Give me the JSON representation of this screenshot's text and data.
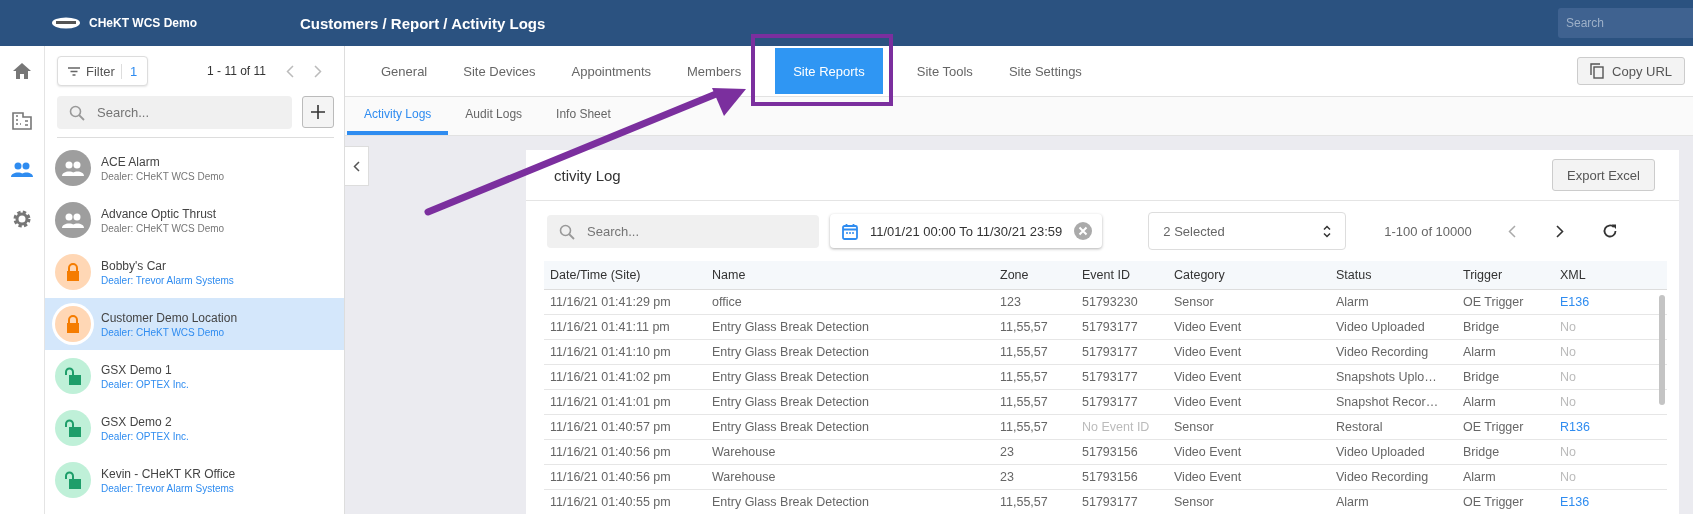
{
  "header": {
    "brand": "CHeKT WCS Demo",
    "breadcrumb": "Customers / Report / Activity Logs",
    "search": {
      "placeholder": "Search"
    }
  },
  "nav_rail": [
    {
      "kind": "home",
      "selected": false
    },
    {
      "kind": "building",
      "selected": false
    },
    {
      "kind": "people",
      "selected": true
    },
    {
      "kind": "gear",
      "selected": false
    }
  ],
  "customer_panel": {
    "filter": {
      "label": "Filter",
      "count": "1"
    },
    "pagination": "1 - 11 of 11",
    "search": {
      "placeholder": "Search..."
    },
    "items": [
      {
        "name": "ACE Alarm",
        "dealer": "Dealer: CHeKT WCS Demo",
        "kind": "group",
        "dealer_link": false,
        "selected": false
      },
      {
        "name": "Advance Optic Thrust",
        "dealer": "Dealer: CHeKT WCS Demo",
        "kind": "group",
        "dealer_link": false,
        "selected": false
      },
      {
        "name": "Bobby's Car",
        "dealer": "Dealer: Trevor Alarm Systems",
        "kind": "locked",
        "dealer_link": true,
        "selected": false
      },
      {
        "name": "Customer Demo Location",
        "dealer": "Dealer: CHeKT WCS Demo",
        "kind": "locked",
        "dealer_link": true,
        "selected": true
      },
      {
        "name": "GSX Demo 1",
        "dealer": "Dealer: OPTEX Inc.",
        "kind": "unlocked",
        "dealer_link": true,
        "selected": false
      },
      {
        "name": "GSX Demo 2",
        "dealer": "Dealer: OPTEX Inc.",
        "kind": "unlocked",
        "dealer_link": true,
        "selected": false
      },
      {
        "name": "Kevin - CHeKT KR Office",
        "dealer": "Dealer: Trevor Alarm Systems",
        "kind": "unlocked",
        "dealer_link": true,
        "selected": false
      }
    ]
  },
  "tabs": [
    {
      "label": "General",
      "selected": false
    },
    {
      "label": "Site Devices",
      "selected": false
    },
    {
      "label": "Appointments",
      "selected": false
    },
    {
      "label": "Members",
      "selected": false
    },
    {
      "label": "Site Reports",
      "selected": true
    },
    {
      "label": "Site Tools",
      "selected": false
    },
    {
      "label": "Site Settings",
      "selected": false
    }
  ],
  "copy_url_button": "Copy URL",
  "subtabs": [
    {
      "label": "Activity Logs",
      "selected": true
    },
    {
      "label": "Audit Logs",
      "selected": false
    },
    {
      "label": "Info Sheet",
      "selected": false
    }
  ],
  "card": {
    "title": "ctivity Log",
    "export_button": "Export Excel",
    "search": {
      "placeholder": "Search..."
    },
    "date_range": "11/01/21 00:00 To 11/30/21 23:59",
    "category_select": "2 Selected",
    "pagination": "1-100 of 10000",
    "table": {
      "columns": [
        "Date/Time (Site)",
        "Name",
        "Zone",
        "Event ID",
        "Category",
        "Status",
        "Trigger",
        "XML"
      ],
      "rows": [
        {
          "datetime": "11/16/21 01:41:29 pm",
          "name": "office",
          "zone": "123",
          "event_id": {
            "text": "51793230",
            "muted": false
          },
          "category": "Sensor",
          "status": "Alarm",
          "trigger": "OE Trigger",
          "xml": {
            "text": "E136",
            "link": true
          }
        },
        {
          "datetime": "11/16/21 01:41:11 pm",
          "name": "Entry Glass Break Detection",
          "zone": "11,55,57",
          "event_id": {
            "text": "51793177",
            "muted": false
          },
          "category": "Video Event",
          "status": "Video Uploaded",
          "trigger": "Bridge",
          "xml": {
            "text": "No",
            "link": false
          }
        },
        {
          "datetime": "11/16/21 01:41:10 pm",
          "name": "Entry Glass Break Detection",
          "zone": "11,55,57",
          "event_id": {
            "text": "51793177",
            "muted": false
          },
          "category": "Video Event",
          "status": "Video Recording",
          "trigger": "Alarm",
          "xml": {
            "text": "No",
            "link": false
          }
        },
        {
          "datetime": "11/16/21 01:41:02 pm",
          "name": "Entry Glass Break Detection",
          "zone": "11,55,57",
          "event_id": {
            "text": "51793177",
            "muted": false
          },
          "category": "Video Event",
          "status": "Snapshots Uplo…",
          "trigger": "Bridge",
          "xml": {
            "text": "No",
            "link": false
          }
        },
        {
          "datetime": "11/16/21 01:41:01 pm",
          "name": "Entry Glass Break Detection",
          "zone": "11,55,57",
          "event_id": {
            "text": "51793177",
            "muted": false
          },
          "category": "Video Event",
          "status": "Snapshot Recor…",
          "trigger": "Alarm",
          "xml": {
            "text": "No",
            "link": false
          }
        },
        {
          "datetime": "11/16/21 01:40:57 pm",
          "name": "Entry Glass Break Detection",
          "zone": "11,55,57",
          "event_id": {
            "text": "No Event ID",
            "muted": true
          },
          "category": "Sensor",
          "status": "Restoral",
          "trigger": "OE Trigger",
          "xml": {
            "text": "R136",
            "link": true
          }
        },
        {
          "datetime": "11/16/21 01:40:56 pm",
          "name": "Warehouse",
          "zone": "23",
          "event_id": {
            "text": "51793156",
            "muted": false
          },
          "category": "Video Event",
          "status": "Video Uploaded",
          "trigger": "Bridge",
          "xml": {
            "text": "No",
            "link": false
          }
        },
        {
          "datetime": "11/16/21 01:40:56 pm",
          "name": "Warehouse",
          "zone": "23",
          "event_id": {
            "text": "51793156",
            "muted": false
          },
          "category": "Video Event",
          "status": "Video Recording",
          "trigger": "Alarm",
          "xml": {
            "text": "No",
            "link": false
          }
        },
        {
          "datetime": "11/16/21 01:40:55 pm",
          "name": "Entry Glass Break Detection",
          "zone": "11,55,57",
          "event_id": {
            "text": "51793177",
            "muted": false
          },
          "category": "Sensor",
          "status": "Alarm",
          "trigger": "OE Trigger",
          "xml": {
            "text": "E136",
            "link": true
          }
        }
      ]
    }
  }
}
